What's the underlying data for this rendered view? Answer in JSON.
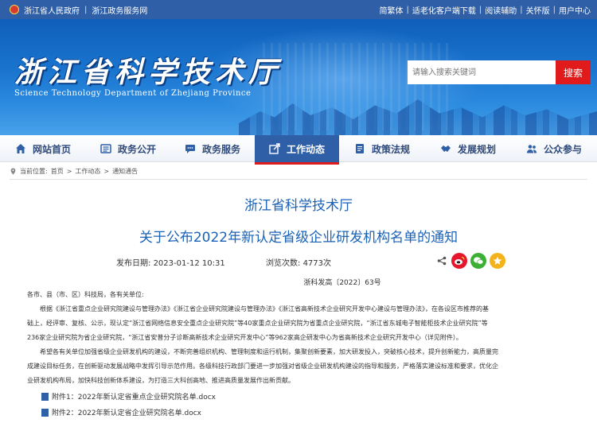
{
  "topbar": {
    "left_links": [
      "浙江省人民政府",
      "浙江政务服务网"
    ],
    "right_links": [
      "简繁体",
      "适老化客户端下载",
      "阅读辅助",
      "关怀版",
      "用户中心"
    ]
  },
  "banner": {
    "title": "浙江省科学技术厅",
    "subtitle": "Science Technology Department of Zhejiang Province",
    "search_placeholder": "请输入搜索关键词",
    "search_button": "搜索"
  },
  "nav": {
    "items": [
      {
        "label": "网站首页",
        "icon": "home-icon"
      },
      {
        "label": "政务公开",
        "icon": "list-icon"
      },
      {
        "label": "政务服务",
        "icon": "chat-icon"
      },
      {
        "label": "工作动态",
        "icon": "share-box-icon"
      },
      {
        "label": "政策法规",
        "icon": "document-icon"
      },
      {
        "label": "发展规划",
        "icon": "handshake-icon"
      },
      {
        "label": "公众参与",
        "icon": "people-icon"
      }
    ],
    "active_index": 3
  },
  "breadcrumb": {
    "prefix": "当前位置:",
    "items": [
      "首页",
      "工作动态",
      "通知通告"
    ],
    "separator": ">"
  },
  "article": {
    "org": "浙江省科学技术厅",
    "title": "关于公布2022年新认定省级企业研发机构名单的通知",
    "publish_label": "发布日期:",
    "publish_date": "2023-01-12 10:31",
    "views_label": "浏览次数:",
    "views": "4773次",
    "doc_number": "浙科发高〔2022〕63号",
    "salutation": "各市、县（市、区）科技局，各有关单位:",
    "para1_lines": [
      "根据《浙江省重点企业研究院建设与管理办法》《浙江省企业研究院建设与管理办法》《浙江省高新技术企业研究开发中心建设与管理办法》，在各设区市推荐的基",
      "础上，经评审、复核、公示，现认定“浙江省网络信息安全重点企业研究院”等40家重点企业研究院为省重点企业研究院，“浙江省东城电子智能柜技术企业研究院”等",
      "236家企业研究院为省企业研究院，“浙江省安普分子诊断高新技术企业研究开发中心”等962家高企研发中心为省高新技术企业研究开发中心（详见附件）。"
    ],
    "para2_lines": [
      "希望各有关单位加强省级企业研发机构的建设，不断完善组织机构、管理制度和运行机制，集聚创新要素，加大研发投入，突破核心技术，提升创新能力，高质量完",
      "成建设目标任务，在创新驱动发展战略中发挥引导示范作用。各级科技行政部门要进一步加强对省级企业研发机构建设的指导和服务，严格落实建设标准和要求，优化企",
      "业研发机构布局，加快科技创新体系建设，为打造三大科创高地、推进高质量发展作出新贡献。"
    ],
    "attachments": [
      "附件1：2022年新认定省重点企业研究院名单.docx",
      "附件2：2022年新认定省企业研究院名单.docx"
    ]
  },
  "colors": {
    "topbar": "#2f5fa6",
    "nav_active": "#2f5fa6",
    "title_blue": "#1a62b6",
    "search_red": "#e11b1b",
    "weibo_red": "#e6162d",
    "wechat_green": "#3cb034",
    "qzone_yellow": "#f4b21b"
  }
}
